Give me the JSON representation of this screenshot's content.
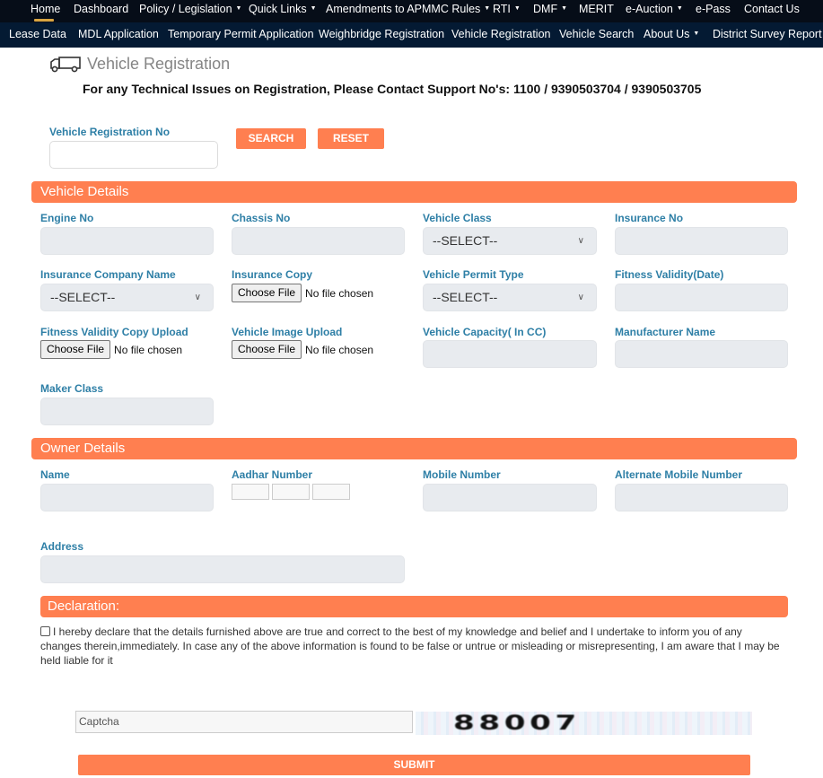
{
  "nav_primary": [
    {
      "label": "Home",
      "dropdown": false,
      "active": true
    },
    {
      "label": "Dashboard",
      "dropdown": false
    },
    {
      "label": "Policy / Legislation",
      "dropdown": true
    },
    {
      "label": "Quick Links",
      "dropdown": true
    },
    {
      "label": "Amendments to APMMC Rules",
      "dropdown": true
    },
    {
      "label": "RTI",
      "dropdown": true
    },
    {
      "label": "DMF",
      "dropdown": true
    },
    {
      "label": "MERIT",
      "dropdown": false
    },
    {
      "label": "e-Auction",
      "dropdown": true
    },
    {
      "label": "e-Pass",
      "dropdown": false
    },
    {
      "label": "Contact Us",
      "dropdown": false
    }
  ],
  "nav_secondary": [
    {
      "label": "Lease Data",
      "dropdown": false
    },
    {
      "label": "MDL Application",
      "dropdown": false
    },
    {
      "label": "Temporary Permit Application",
      "dropdown": false
    },
    {
      "label": "Weighbridge Registration",
      "dropdown": false
    },
    {
      "label": "Vehicle Registration",
      "dropdown": false
    },
    {
      "label": "Vehicle Search",
      "dropdown": false
    },
    {
      "label": "About Us",
      "dropdown": true
    },
    {
      "label": "District Survey Report",
      "dropdown": true
    }
  ],
  "page": {
    "title": "Vehicle Registration",
    "support_notice": "For any Technical Issues on Registration, Please Contact Support No's: 1100 / 9390503704 / 9390503705"
  },
  "search": {
    "label": "Vehicle Registration No",
    "value": "",
    "search_button": "SEARCH",
    "reset_button": "RESET"
  },
  "vehicle_details": {
    "heading": "Vehicle Details",
    "engine_no": {
      "label": "Engine No",
      "value": ""
    },
    "chassis_no": {
      "label": "Chassis No",
      "value": ""
    },
    "vehicle_class": {
      "label": "Vehicle Class",
      "selected": "--SELECT--"
    },
    "insurance_no": {
      "label": "Insurance No",
      "value": ""
    },
    "insurance_company": {
      "label": "Insurance Company Name",
      "selected": "--SELECT--"
    },
    "insurance_copy": {
      "label": "Insurance Copy",
      "button": "Choose File",
      "status": "No file chosen"
    },
    "permit_type": {
      "label": "Vehicle Permit Type",
      "selected": "--SELECT--"
    },
    "fitness_validity": {
      "label": "Fitness Validity(Date)",
      "value": ""
    },
    "fitness_copy": {
      "label": "Fitness Validity Copy Upload",
      "button": "Choose File",
      "status": "No file chosen"
    },
    "vehicle_image": {
      "label": "Vehicle Image Upload",
      "button": "Choose File",
      "status": "No file chosen"
    },
    "capacity": {
      "label": "Vehicle Capacity( In CC)",
      "value": ""
    },
    "manufacturer": {
      "label": "Manufacturer Name",
      "value": ""
    },
    "maker_class": {
      "label": "Maker Class",
      "value": ""
    }
  },
  "owner_details": {
    "heading": "Owner Details",
    "name": {
      "label": "Name",
      "value": ""
    },
    "aadhar": {
      "label": "Aadhar Number",
      "parts": [
        "",
        "",
        ""
      ]
    },
    "mobile": {
      "label": "Mobile Number",
      "value": ""
    },
    "alt_mobile": {
      "label": "Alternate Mobile Number",
      "value": ""
    },
    "address": {
      "label": "Address",
      "value": ""
    }
  },
  "declaration": {
    "heading": "Declaration:",
    "checked": false,
    "text": "I hereby declare that the details furnished above are true and correct to the best of my knowledge and belief and I undertake to inform you of any changes therein,immediately. In case any of the above information is found to be false or untrue or misleading or misrepresenting, I am aware that I may be held liable for it"
  },
  "captcha": {
    "placeholder": "Captcha",
    "code": "88007"
  },
  "submit_label": "SUBMIT",
  "colors": {
    "accent": "#ff7f50",
    "nav_top": "#060d18",
    "nav_bottom": "#041a33",
    "label": "#2e7fa6",
    "home_underline": "#d9a441"
  }
}
